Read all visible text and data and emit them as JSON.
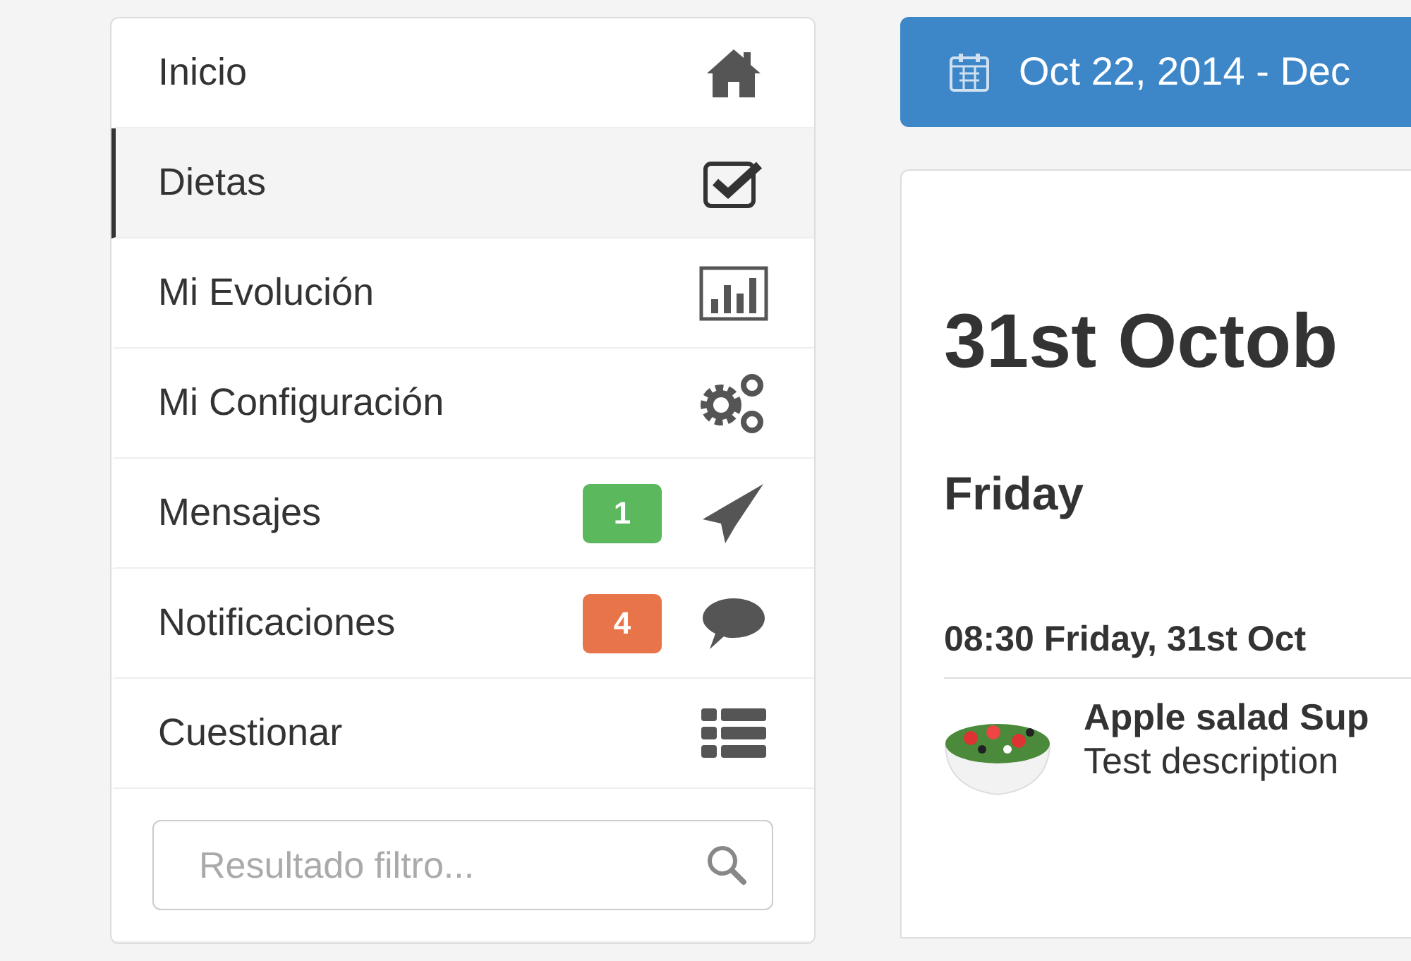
{
  "sidebar": {
    "items": [
      {
        "label": "Inicio",
        "selected": false
      },
      {
        "label": "Dietas",
        "selected": true
      },
      {
        "label": "Mi Evolución",
        "selected": false
      },
      {
        "label": "Mi Configuración",
        "selected": false
      },
      {
        "label": "Mensajes",
        "selected": false,
        "badge": {
          "text": "1",
          "color": "#5cb85c"
        }
      },
      {
        "label": "Notificaciones",
        "selected": false,
        "badge": {
          "text": "4",
          "color": "#e8754a"
        }
      },
      {
        "label": "Cuestionar",
        "selected": false
      }
    ],
    "search": {
      "placeholder": "Resultado filtro..."
    }
  },
  "main": {
    "date_range": "Oct 22, 2014 - Dec",
    "title": "31st Octob",
    "day": "Friday",
    "meal_time": "08:30 Friday, 31st Oct",
    "meal": {
      "name": "Apple salad Sup",
      "description": "Test description"
    }
  }
}
